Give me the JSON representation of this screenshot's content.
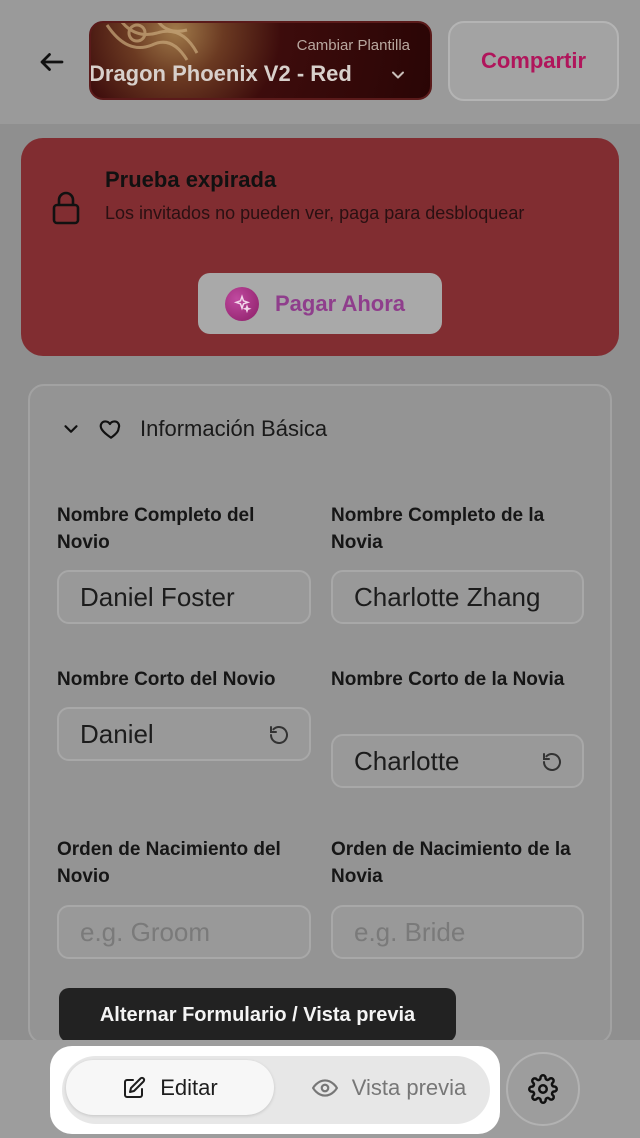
{
  "header": {
    "template_subtitle": "Cambiar Plantilla",
    "template_name": "Dragon Phoenix V2 - Red",
    "share_label": "Compartir"
  },
  "banner": {
    "title": "Prueba expirada",
    "description": "Los invitados no pueden ver, paga para desbloquear",
    "pay_label": "Pagar Ahora"
  },
  "form": {
    "section_title": "Información Básica",
    "groom_full_name": {
      "label": "Nombre Completo del Novio",
      "value": "Daniel Foster"
    },
    "bride_full_name": {
      "label": "Nombre Completo de la Novia",
      "value": "Charlotte Zhang"
    },
    "groom_short_name": {
      "label": "Nombre Corto del Novio",
      "value": "Daniel"
    },
    "bride_short_name": {
      "label": "Nombre Corto de la Novia",
      "value": "Charlotte"
    },
    "groom_birth_order": {
      "label": "Orden de Nacimiento del Novio",
      "placeholder": "e.g. Groom"
    },
    "bride_birth_order": {
      "label": "Orden de Nacimiento de la Novia",
      "placeholder": "e.g. Bride"
    }
  },
  "tooltip": {
    "text": "Alternar Formulario / Vista previa"
  },
  "bottom_bar": {
    "edit_label": "Editar",
    "preview_label": "Vista previa"
  },
  "icons": {
    "back": "arrow-left-icon",
    "chevron": "chevron-down-icon",
    "lock": "lock-icon",
    "sparkle": "sparkle-icon",
    "heart": "heart-icon",
    "reset": "reset-icon",
    "edit": "pencil-square-icon",
    "preview": "eye-icon",
    "settings": "gear-icon"
  },
  "colors": {
    "share_text": "#b0155b",
    "banner_bg": "#812d31",
    "pay_text": "#8f3e8c"
  }
}
